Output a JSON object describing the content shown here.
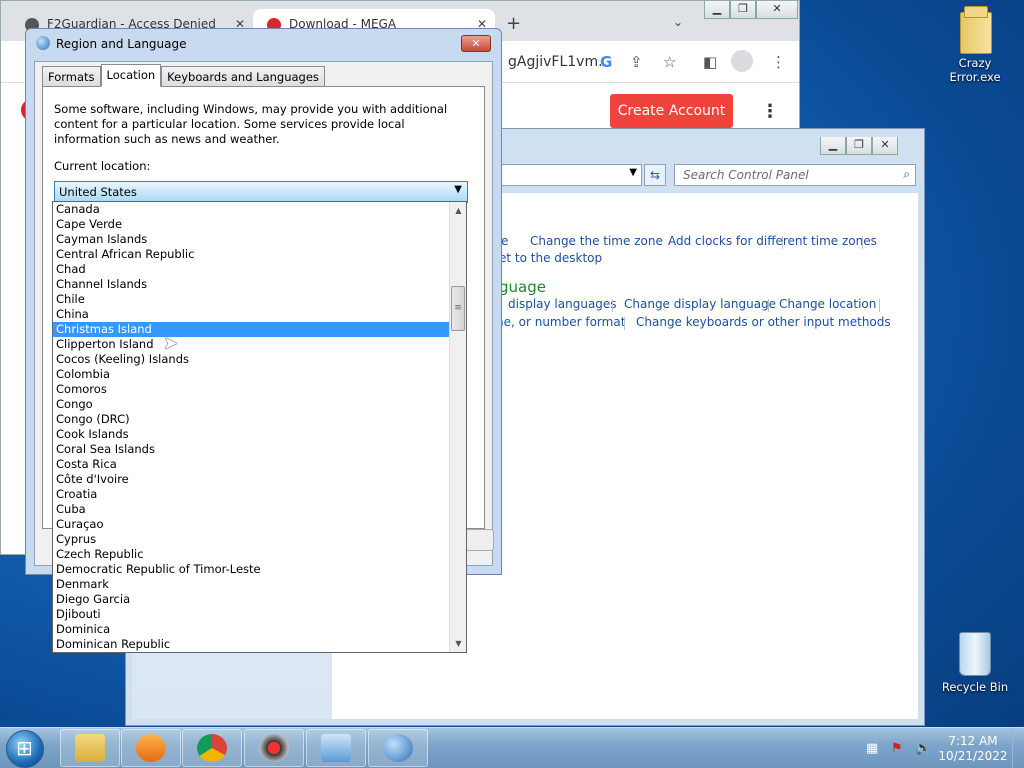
{
  "desktop": {
    "icons": [
      {
        "label": "Crazy Error.exe"
      },
      {
        "label": "Recycle Bin"
      }
    ]
  },
  "chrome": {
    "tabs": [
      {
        "title": "F2Guardian - Access Denied"
      },
      {
        "title": "Download - MEGA"
      }
    ],
    "new_tab": "+",
    "url_fragment": "gAgjivFL1vm...",
    "create_account": "Create Account"
  },
  "control_panel": {
    "search_placeholder": "Search Control Panel",
    "links_row1": [
      "e",
      "Change the time zone",
      "Add clocks for different time zones"
    ],
    "link_desktop": "et to the desktop",
    "heading": "guage",
    "links_row2": [
      "display languages",
      "Change display language",
      "Change location"
    ],
    "links_row3": [
      "ne, or number format",
      "Change keyboards or other input methods"
    ]
  },
  "dialog": {
    "title": "Region and Language",
    "close": "✕",
    "tabs": [
      "Formats",
      "Location",
      "Keyboards and Languages"
    ],
    "intro": "Some software, including Windows, may provide you with additional content for a particular location. Some services provide local information such as news and weather.",
    "current_location_label": "Current location:",
    "current_location_value": "United States"
  },
  "dropdown": {
    "selected": "Christmas Island",
    "items": [
      "Canada",
      "Cape Verde",
      "Cayman Islands",
      "Central African Republic",
      "Chad",
      "Channel Islands",
      "Chile",
      "China",
      "Christmas Island",
      "Clipperton Island",
      "Cocos (Keeling) Islands",
      "Colombia",
      "Comoros",
      "Congo",
      "Congo (DRC)",
      "Cook Islands",
      "Coral Sea Islands",
      "Costa Rica",
      "Côte d'Ivoire",
      "Croatia",
      "Cuba",
      "Curaçao",
      "Cyprus",
      "Czech Republic",
      "Democratic Republic of Timor-Leste",
      "Denmark",
      "Diego Garcia",
      "Djibouti",
      "Dominica",
      "Dominican Republic"
    ]
  },
  "taskbar": {
    "time": "7:12 AM",
    "date": "10/21/2022"
  }
}
